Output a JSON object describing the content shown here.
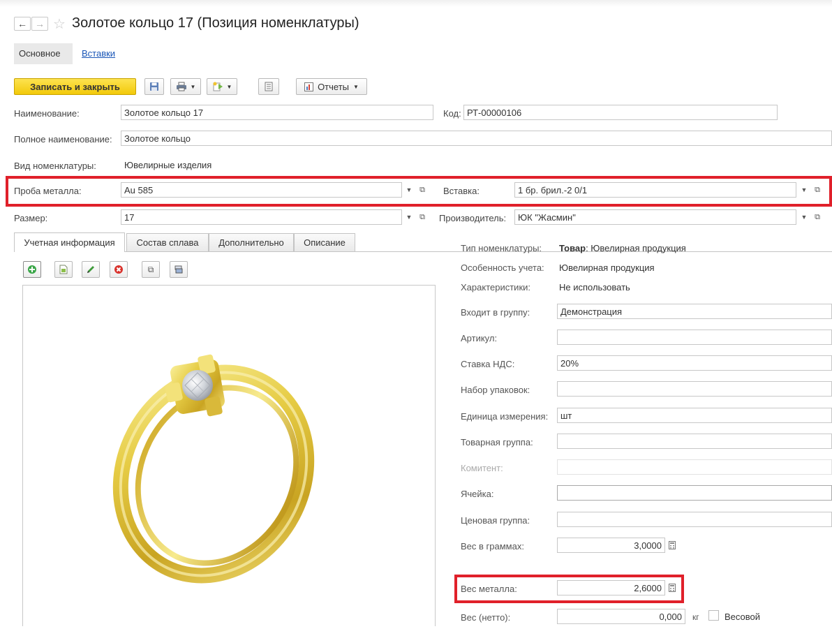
{
  "window": {
    "back_icon": "arrow-left-icon",
    "forward_icon": "arrow-right-icon",
    "favorite_icon": "star-icon",
    "title": "Золотое кольцо 17 (Позиция номенклатуры)"
  },
  "sections": {
    "main": "Основное",
    "inserts": "Вставки"
  },
  "toolbar": {
    "save_close": "Записать и закрыть",
    "reports": "Отчеты"
  },
  "fields": {
    "name_label": "Наименование:",
    "name_value": "Золотое кольцо 17",
    "code_label": "Код:",
    "code_value": "РТ-00000106",
    "full_name_label": "Полное наименование:",
    "full_name_value": "Золотое кольцо",
    "kind_label": "Вид номенклатуры:",
    "kind_value": "Ювелирные изделия",
    "assay_label": "Проба металла:",
    "assay_value": "Au 585",
    "insert_label": "Вставка:",
    "insert_value": "1 бр. брил.-2 0/1",
    "size_label": "Размер:",
    "size_value": "17",
    "maker_label": "Производитель:",
    "maker_value": "ЮК \"Жасмин\""
  },
  "tabs": [
    "Учетная информация",
    "Состав сплава",
    "Дополнительно",
    "Описание"
  ],
  "details": {
    "type_label": "Тип номенклатуры:",
    "type_bold": "Товар",
    "type_rest": ": Ювелирная продукция",
    "feature_label": "Особенность учета:",
    "feature_value": "Ювелирная продукция",
    "chars_label": "Характеристики:",
    "chars_value": "Не использовать",
    "group_label": "Входит в группу:",
    "group_value": "Демонстрация",
    "article_label": "Артикул:",
    "article_value": "",
    "vat_label": "Ставка НДС:",
    "vat_value": "20%",
    "packs_label": "Набор упаковок:",
    "packs_value": "",
    "unit_label": "Единица измерения:",
    "unit_value": "шт",
    "goods_group_label": "Товарная группа:",
    "goods_group_value": "",
    "consignor_label": "Комитент:",
    "consignor_value": "",
    "cell_label": "Ячейка:",
    "cell_value": "",
    "price_group_label": "Ценовая группа:",
    "price_group_value": "",
    "weight_label": "Вес в граммах:",
    "weight_value": "3,0000",
    "metal_weight_label": "Вес металла:",
    "metal_weight_value": "2,6000",
    "net_label": "Вес (нетто):",
    "net_value": "0,000",
    "net_unit": "кг",
    "weighted_label": "Весовой"
  },
  "colors": {
    "highlight": "#e0202a",
    "primary_button": "#f2c90a",
    "link": "#1a56b7"
  }
}
